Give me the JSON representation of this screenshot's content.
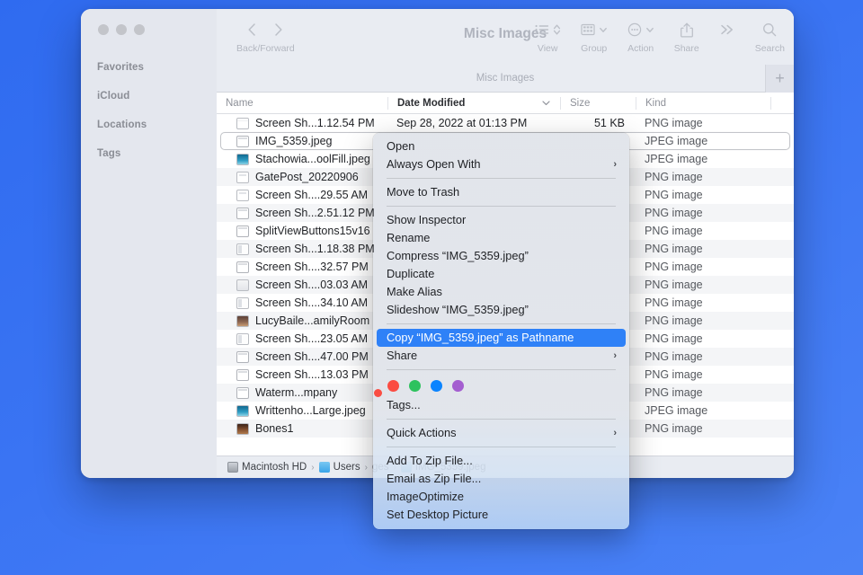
{
  "window": {
    "title": "Misc Images",
    "tab_title": "Misc Images",
    "add_tab_label": "+"
  },
  "toolbar": {
    "back_forward_label": "Back/Forward",
    "view_label": "View",
    "group_label": "Group",
    "action_label": "Action",
    "share_label": "Share",
    "search_label": "Search",
    "icons": {
      "back": "chevron-left-icon",
      "forward": "chevron-right-icon",
      "view": "list-view-icon",
      "view_caret": "updown-caret-icon",
      "group": "grid-icon",
      "group_caret": "chevron-down-icon",
      "action": "circle-ellipsis-icon",
      "action_caret": "chevron-down-icon",
      "share": "share-arrow-icon",
      "more": "double-chevron-icon",
      "search": "magnifier-icon"
    }
  },
  "sidebar": {
    "sections": [
      {
        "label": "Favorites"
      },
      {
        "label": "iCloud"
      },
      {
        "label": "Locations"
      },
      {
        "label": "Tags"
      }
    ]
  },
  "columns": {
    "name": "Name",
    "date_modified": "Date Modified",
    "size": "Size",
    "kind": "Kind"
  },
  "files": [
    {
      "name": "Screen Sh...1.12.54 PM",
      "date": "Sep 28, 2022 at 01:13 PM",
      "size": "51 KB",
      "kind": "PNG image",
      "icon": "doc",
      "selected": false,
      "tag": null
    },
    {
      "name": "IMG_5359.jpeg",
      "date": "",
      "size": "",
      "kind": "JPEG image",
      "icon": "win",
      "selected": true,
      "tag": null
    },
    {
      "name": "Stachowia...oolFill.jpeg",
      "date": "",
      "size": "",
      "kind": "JPEG image",
      "icon": "photo2",
      "selected": false,
      "tag": null
    },
    {
      "name": "GatePost_20220906",
      "date": "",
      "size": "",
      "kind": "PNG image",
      "icon": "port",
      "selected": false,
      "tag": null
    },
    {
      "name": "Screen Sh....29.55 AM",
      "date": "",
      "size": "",
      "kind": "PNG image",
      "icon": "port",
      "selected": false,
      "tag": null
    },
    {
      "name": "Screen Sh...2.51.12 PM",
      "date": "",
      "size": "",
      "kind": "PNG image",
      "icon": "win",
      "selected": false,
      "tag": null
    },
    {
      "name": "SplitViewButtons15v16",
      "date": "",
      "size": "",
      "kind": "PNG image",
      "icon": "win",
      "selected": false,
      "tag": null
    },
    {
      "name": "Screen Sh...1.18.38 PM",
      "date": "",
      "size": "",
      "kind": "PNG image",
      "icon": "sidebarwin",
      "selected": false,
      "tag": null
    },
    {
      "name": "Screen Sh....32.57 PM",
      "date": "",
      "size": "",
      "kind": "PNG image",
      "icon": "win",
      "selected": false,
      "tag": null
    },
    {
      "name": "Screen Sh....03.03 AM",
      "date": "",
      "size": "",
      "kind": "PNG image",
      "icon": "grey",
      "selected": false,
      "tag": null
    },
    {
      "name": "Screen Sh....34.10 AM",
      "date": "",
      "size": "",
      "kind": "PNG image",
      "icon": "sidebarwin",
      "selected": false,
      "tag": null
    },
    {
      "name": "LucyBaile...amilyRoom",
      "date": "",
      "size": "",
      "kind": "PNG image",
      "icon": "photo",
      "selected": false,
      "tag": null
    },
    {
      "name": "Screen Sh....23.05 AM",
      "date": "",
      "size": "",
      "kind": "PNG image",
      "icon": "sidebarwin",
      "selected": false,
      "tag": null
    },
    {
      "name": "Screen Sh....47.00 PM",
      "date": "",
      "size": "",
      "kind": "PNG image",
      "icon": "win",
      "selected": false,
      "tag": null
    },
    {
      "name": "Screen Sh....13.03 PM",
      "date": "",
      "size": "",
      "kind": "PNG image",
      "icon": "win",
      "selected": false,
      "tag": null
    },
    {
      "name": "Waterm...mpany",
      "date": "",
      "size": "",
      "kind": "PNG image",
      "icon": "win",
      "selected": false,
      "tag": "#fa4d43"
    },
    {
      "name": "Writtenho...Large.jpeg",
      "date": "",
      "size": "",
      "kind": "JPEG image",
      "icon": "photo2",
      "selected": false,
      "tag": null
    },
    {
      "name": "Bones1",
      "date": "",
      "size": "",
      "kind": "PNG image",
      "icon": "photo3",
      "selected": false,
      "tag": null
    }
  ],
  "pathbar": {
    "items": [
      {
        "label": "Macintosh HD",
        "icon": "hard-drive-icon"
      },
      {
        "label": "Users",
        "icon": "folder-icon"
      },
      {
        "label": "ges",
        "icon": null
      },
      {
        "label": "IMG_5359.jpeg",
        "icon": "image-file-icon"
      }
    ],
    "separator": "›"
  },
  "context_menu": {
    "items": [
      {
        "label": "Open",
        "type": "item",
        "submenu": false,
        "highlighted": false
      },
      {
        "label": "Always Open With",
        "type": "item",
        "submenu": true,
        "highlighted": false
      },
      {
        "type": "separator"
      },
      {
        "label": "Move to Trash",
        "type": "item",
        "submenu": false,
        "highlighted": false
      },
      {
        "type": "separator"
      },
      {
        "label": "Show Inspector",
        "type": "item",
        "submenu": false,
        "highlighted": false
      },
      {
        "label": "Rename",
        "type": "item",
        "submenu": false,
        "highlighted": false
      },
      {
        "label": "Compress “IMG_5359.jpeg”",
        "type": "item",
        "submenu": false,
        "highlighted": false
      },
      {
        "label": "Duplicate",
        "type": "item",
        "submenu": false,
        "highlighted": false
      },
      {
        "label": "Make Alias",
        "type": "item",
        "submenu": false,
        "highlighted": false
      },
      {
        "label": "Slideshow “IMG_5359.jpeg”",
        "type": "item",
        "submenu": false,
        "highlighted": false
      },
      {
        "type": "separator"
      },
      {
        "label": "Copy “IMG_5359.jpeg” as Pathname",
        "type": "item",
        "submenu": false,
        "highlighted": true
      },
      {
        "label": "Share",
        "type": "item",
        "submenu": true,
        "highlighted": false
      },
      {
        "type": "separator"
      },
      {
        "type": "tags",
        "colors": [
          "#fb4c42",
          "#2ec25e",
          "#0b84ff",
          "#a45ed0"
        ]
      },
      {
        "label": "Tags...",
        "type": "item",
        "submenu": false,
        "highlighted": false
      },
      {
        "type": "separator"
      },
      {
        "label": "Quick Actions",
        "type": "item",
        "submenu": true,
        "highlighted": false
      },
      {
        "type": "separator"
      },
      {
        "label": "Add To Zip File...",
        "type": "item",
        "submenu": false,
        "highlighted": false
      },
      {
        "label": "Email as Zip File...",
        "type": "item",
        "submenu": false,
        "highlighted": false
      },
      {
        "label": "ImageOptimize",
        "type": "item",
        "submenu": false,
        "highlighted": false
      },
      {
        "label": "Set Desktop Picture",
        "type": "item",
        "submenu": false,
        "highlighted": false
      }
    ],
    "highlight_color": "#2f81f7",
    "submenu_arrow": "›"
  }
}
